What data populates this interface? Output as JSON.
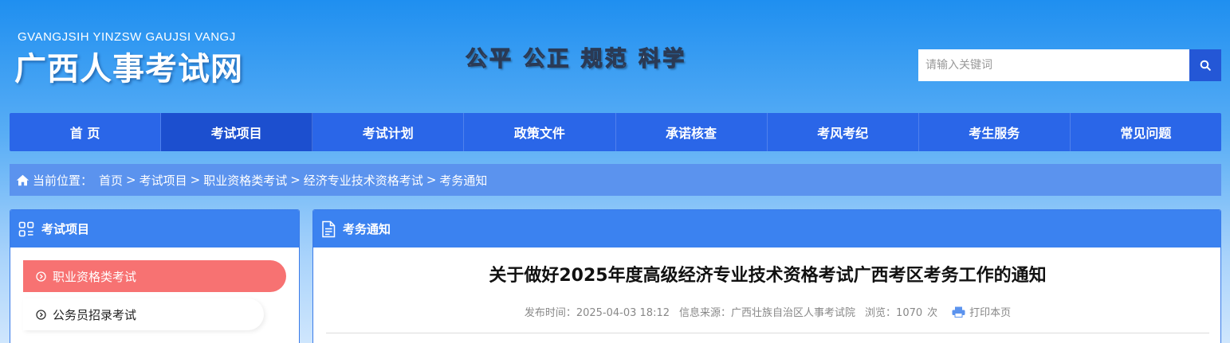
{
  "header": {
    "logo_en": "GVANGJSIH YINZSW GAUJSI VANGJ",
    "logo_cn": "广西人事考试网",
    "slogan": "公平 公正 规范 科学",
    "search_placeholder": "请输入关键词"
  },
  "nav": {
    "items": [
      "首 页",
      "考试项目",
      "考试计划",
      "政策文件",
      "承诺核查",
      "考风考纪",
      "考生服务",
      "常见问题"
    ],
    "active_index": 1
  },
  "breadcrumb": {
    "label": "当前位置：",
    "items": [
      "首页",
      "考试项目",
      "职业资格类考试",
      "经济专业技术资格考试",
      "考务通知"
    ]
  },
  "sidebar": {
    "title": "考试项目",
    "items": [
      "职业资格类考试",
      "公务员招录考试"
    ]
  },
  "article": {
    "section": "考务通知",
    "title": "关于做好2025年度高级经济专业技术资格考试广西考区考务工作的通知",
    "publish_label": "发布时间：",
    "publish_time": "2025-04-03 18:12",
    "source_label": "信息来源：",
    "source": "广西壮族自治区人事考试院",
    "views_label": "浏览：",
    "views": "1070",
    "views_unit": "次",
    "print_label": "打印本页"
  },
  "colors": {
    "nav_bg": "#2a66e8",
    "nav_active": "#1c4fcf",
    "crumb_bg": "#5b93ee",
    "panel_head": "#3b82f0",
    "side_active": "#f77272",
    "search_btn": "#2457d6"
  }
}
